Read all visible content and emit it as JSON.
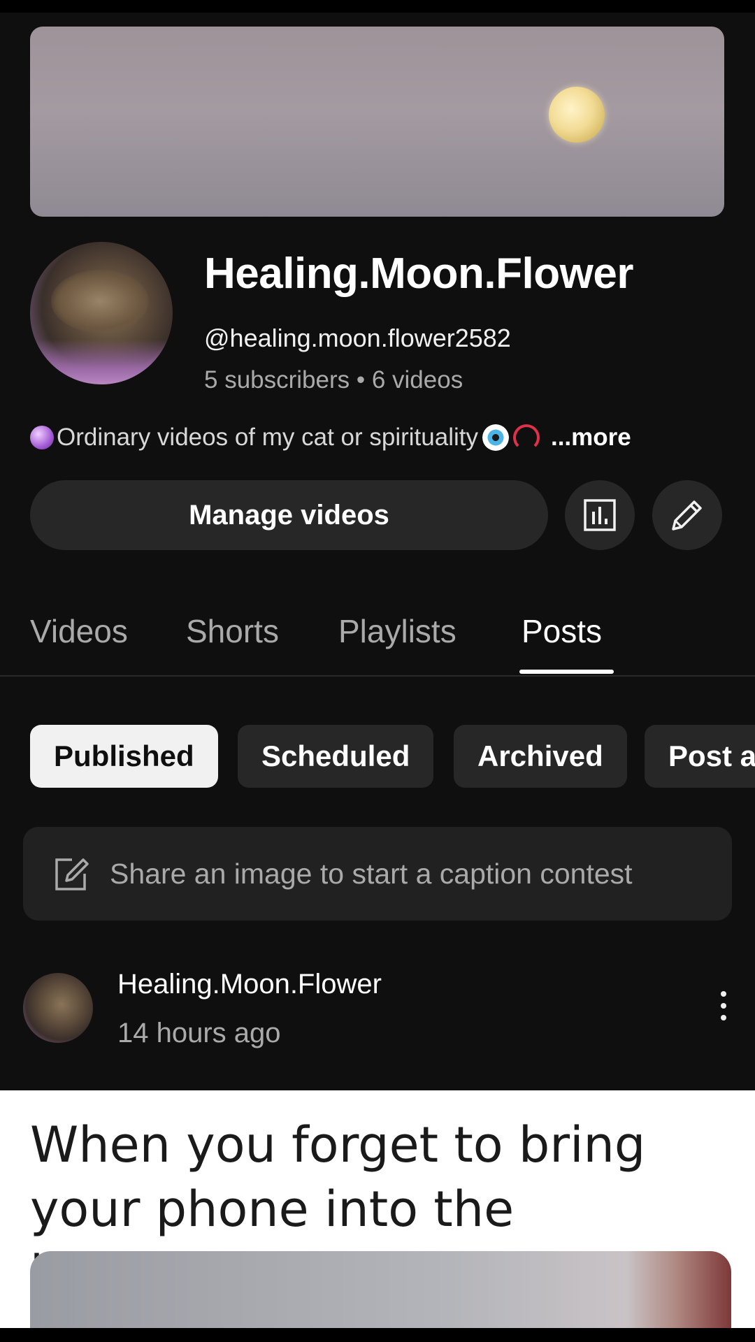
{
  "channel": {
    "name": "Healing.Moon.Flower",
    "handle": "@healing.moon.flower2582",
    "stats": "5 subscribers • 6 videos",
    "description": "Ordinary videos of my cat or spirituality",
    "more_label": "...more"
  },
  "actions": {
    "manage_label": "Manage videos",
    "analytics_icon": "analytics-icon",
    "edit_icon": "pencil-icon"
  },
  "tabs": [
    {
      "label": "Videos",
      "active": false
    },
    {
      "label": "Shorts",
      "active": false
    },
    {
      "label": "Playlists",
      "active": false
    },
    {
      "label": "Posts",
      "active": true
    }
  ],
  "chips": [
    {
      "label": "Published",
      "active": true
    },
    {
      "label": "Scheduled",
      "active": false
    },
    {
      "label": "Archived",
      "active": false
    },
    {
      "label": "Post a",
      "active": false
    }
  ],
  "contest": {
    "text": "Share an image to start a caption contest"
  },
  "post": {
    "author": "Healing.Moon.Flower",
    "time": "14 hours ago",
    "image_text": "When you forget to bring your phone into the bathroom"
  }
}
